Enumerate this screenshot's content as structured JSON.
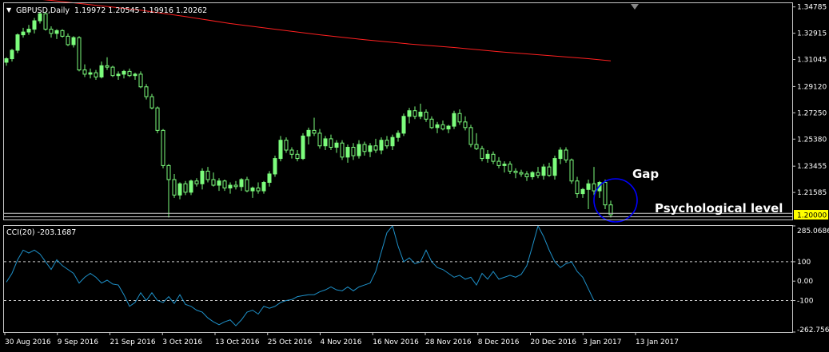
{
  "header": {
    "menu_arrow": "▼",
    "symbol_text": "GBPUSD,Daily  1.19972 1.20545 1.19916 1.20262"
  },
  "subwindow": {
    "label": "CCI(20) -203.1687"
  },
  "colors": {
    "background": "#000000",
    "border": "#c8c8c8",
    "bull_candle": "#7cfc7c",
    "bear_candle": "#000000",
    "wick": "#7cfc7c",
    "moving_average": "#ff2020",
    "cci_line": "#1e90c8",
    "annotation_circle": "#0000ff",
    "price_tag_bg": "#ffff00"
  },
  "chart_data": [
    {
      "type": "candlestick",
      "title": "GBPUSD,Daily",
      "x_labels": [
        "30 Aug 2016",
        "9 Sep 2016",
        "21 Sep 2016",
        "3 Oct 2016",
        "13 Oct 2016",
        "25 Oct 2016",
        "4 Nov 2016",
        "16 Nov 2016",
        "28 Nov 2016",
        "8 Dec 2016",
        "20 Dec 2016",
        "3 Jan 2017",
        "13 Jan 2017"
      ],
      "y_ticks": [
        "1.34785",
        "1.32915",
        "1.31045",
        "1.29120",
        "1.27250",
        "1.25380",
        "1.23455",
        "1.21585"
      ],
      "ylim": [
        1.1966,
        1.3505
      ],
      "current_price_label": "1.20000",
      "horizontal_levels": [
        1.201,
        1.1985
      ],
      "annotations": {
        "gap": "Gap",
        "psych": "Psychological level"
      },
      "candles": [
        [
          1.3085,
          1.312,
          1.306,
          1.311
        ],
        [
          1.311,
          1.318,
          1.309,
          1.317
        ],
        [
          1.317,
          1.329,
          1.315,
          1.328
        ],
        [
          1.328,
          1.333,
          1.326,
          1.33
        ],
        [
          1.33,
          1.335,
          1.328,
          1.332
        ],
        [
          1.332,
          1.34,
          1.329,
          1.338
        ],
        [
          1.338,
          1.344,
          1.336,
          1.343
        ],
        [
          1.343,
          1.3445,
          1.331,
          1.332
        ],
        [
          1.332,
          1.334,
          1.326,
          1.329
        ],
        [
          1.329,
          1.332,
          1.325,
          1.331
        ],
        [
          1.331,
          1.332,
          1.326,
          1.327
        ],
        [
          1.327,
          1.329,
          1.32,
          1.321
        ],
        [
          1.321,
          1.327,
          1.319,
          1.326
        ],
        [
          1.326,
          1.327,
          1.302,
          1.303
        ],
        [
          1.303,
          1.307,
          1.298,
          1.3
        ],
        [
          1.3,
          1.304,
          1.297,
          1.301
        ],
        [
          1.301,
          1.303,
          1.296,
          1.298
        ],
        [
          1.298,
          1.309,
          1.297,
          1.306
        ],
        [
          1.306,
          1.312,
          1.303,
          1.305
        ],
        [
          1.305,
          1.306,
          1.298,
          1.299
        ],
        [
          1.299,
          1.302,
          1.296,
          1.3
        ],
        [
          1.3,
          1.303,
          1.297,
          1.302
        ],
        [
          1.302,
          1.304,
          1.298,
          1.299
        ],
        [
          1.299,
          1.301,
          1.296,
          1.3
        ],
        [
          1.3,
          1.302,
          1.29,
          1.291
        ],
        [
          1.291,
          1.293,
          1.282,
          1.284
        ],
        [
          1.284,
          1.286,
          1.275,
          1.276
        ],
        [
          1.276,
          1.277,
          1.258,
          1.26
        ],
        [
          1.26,
          1.261,
          1.233,
          1.235
        ],
        [
          1.235,
          1.236,
          1.198,
          1.225
        ],
        [
          1.225,
          1.229,
          1.212,
          1.214
        ],
        [
          1.214,
          1.223,
          1.211,
          1.222
        ],
        [
          1.222,
          1.224,
          1.214,
          1.216
        ],
        [
          1.216,
          1.225,
          1.214,
          1.224
        ],
        [
          1.224,
          1.226,
          1.22,
          1.222
        ],
        [
          1.222,
          1.233,
          1.218,
          1.231
        ],
        [
          1.231,
          1.234,
          1.223,
          1.225
        ],
        [
          1.225,
          1.23,
          1.22,
          1.221
        ],
        [
          1.221,
          1.226,
          1.217,
          1.224
        ],
        [
          1.224,
          1.225,
          1.217,
          1.219
        ],
        [
          1.219,
          1.223,
          1.215,
          1.221
        ],
        [
          1.221,
          1.224,
          1.218,
          1.22
        ],
        [
          1.22,
          1.226,
          1.217,
          1.225
        ],
        [
          1.225,
          1.227,
          1.216,
          1.217
        ],
        [
          1.217,
          1.22,
          1.212,
          1.219
        ],
        [
          1.219,
          1.223,
          1.215,
          1.217
        ],
        [
          1.217,
          1.224,
          1.215,
          1.223
        ],
        [
          1.223,
          1.231,
          1.22,
          1.229
        ],
        [
          1.229,
          1.242,
          1.227,
          1.24
        ],
        [
          1.24,
          1.256,
          1.238,
          1.253
        ],
        [
          1.253,
          1.255,
          1.244,
          1.246
        ],
        [
          1.246,
          1.248,
          1.24,
          1.243
        ],
        [
          1.243,
          1.246,
          1.238,
          1.24
        ],
        [
          1.24,
          1.258,
          1.239,
          1.256
        ],
        [
          1.256,
          1.262,
          1.25,
          1.26
        ],
        [
          1.26,
          1.269,
          1.256,
          1.258
        ],
        [
          1.258,
          1.261,
          1.247,
          1.249
        ],
        [
          1.249,
          1.256,
          1.246,
          1.254
        ],
        [
          1.254,
          1.257,
          1.246,
          1.248
        ],
        [
          1.248,
          1.253,
          1.244,
          1.251
        ],
        [
          1.251,
          1.253,
          1.239,
          1.241
        ],
        [
          1.241,
          1.25,
          1.237,
          1.248
        ],
        [
          1.248,
          1.251,
          1.239,
          1.242
        ],
        [
          1.242,
          1.253,
          1.24,
          1.25
        ],
        [
          1.25,
          1.252,
          1.242,
          1.245
        ],
        [
          1.245,
          1.251,
          1.241,
          1.249
        ],
        [
          1.249,
          1.254,
          1.244,
          1.246
        ],
        [
          1.246,
          1.255,
          1.243,
          1.253
        ],
        [
          1.253,
          1.256,
          1.247,
          1.249
        ],
        [
          1.249,
          1.257,
          1.246,
          1.255
        ],
        [
          1.255,
          1.26,
          1.252,
          1.258
        ],
        [
          1.258,
          1.272,
          1.256,
          1.27
        ],
        [
          1.27,
          1.276,
          1.265,
          1.274
        ],
        [
          1.274,
          1.277,
          1.268,
          1.27
        ],
        [
          1.27,
          1.279,
          1.268,
          1.273
        ],
        [
          1.273,
          1.275,
          1.266,
          1.268
        ],
        [
          1.268,
          1.27,
          1.261,
          1.262
        ],
        [
          1.262,
          1.266,
          1.258,
          1.264
        ],
        [
          1.264,
          1.267,
          1.26,
          1.261
        ],
        [
          1.261,
          1.264,
          1.258,
          1.263
        ],
        [
          1.263,
          1.274,
          1.261,
          1.272
        ],
        [
          1.272,
          1.275,
          1.264,
          1.266
        ],
        [
          1.266,
          1.27,
          1.26,
          1.262
        ],
        [
          1.262,
          1.264,
          1.248,
          1.25
        ],
        [
          1.25,
          1.258,
          1.246,
          1.247
        ],
        [
          1.247,
          1.249,
          1.238,
          1.24
        ],
        [
          1.24,
          1.246,
          1.237,
          1.243
        ],
        [
          1.243,
          1.245,
          1.236,
          1.238
        ],
        [
          1.238,
          1.241,
          1.233,
          1.235
        ],
        [
          1.235,
          1.238,
          1.23,
          1.236
        ],
        [
          1.236,
          1.238,
          1.229,
          1.231
        ],
        [
          1.231,
          1.233,
          1.226,
          1.23
        ],
        [
          1.23,
          1.232,
          1.227,
          1.229
        ],
        [
          1.229,
          1.231,
          1.224,
          1.227
        ],
        [
          1.227,
          1.231,
          1.225,
          1.23
        ],
        [
          1.23,
          1.234,
          1.226,
          1.228
        ],
        [
          1.228,
          1.236,
          1.225,
          1.234
        ],
        [
          1.234,
          1.237,
          1.227,
          1.228
        ],
        [
          1.228,
          1.242,
          1.225,
          1.24
        ],
        [
          1.24,
          1.248,
          1.236,
          1.246
        ],
        [
          1.246,
          1.248,
          1.237,
          1.239
        ],
        [
          1.239,
          1.24,
          1.222,
          1.224
        ],
        [
          1.224,
          1.227,
          1.212,
          1.215
        ],
        [
          1.215,
          1.219,
          1.212,
          1.218
        ],
        [
          1.218,
          1.225,
          1.204,
          1.222
        ],
        [
          1.222,
          1.234,
          1.214,
          1.217
        ],
        [
          1.217,
          1.224,
          1.212,
          1.223
        ],
        [
          1.223,
          1.225,
          1.204,
          1.207
        ],
        [
          1.207,
          1.21,
          1.198,
          1.2
        ]
      ]
    },
    {
      "type": "line",
      "series_name": "moving average",
      "x_index": [
        0,
        8,
        16,
        24,
        32,
        40,
        48,
        56,
        64,
        72,
        80,
        88,
        96,
        104,
        108
      ],
      "values": [
        1.3555,
        1.3525,
        1.349,
        1.3455,
        1.341,
        1.336,
        1.332,
        1.328,
        1.3245,
        1.3215,
        1.319,
        1.316,
        1.3135,
        1.311,
        1.3095
      ]
    },
    {
      "type": "line",
      "title": "CCI(20) -203.1687",
      "y_ticks": [
        "285.0686",
        "100",
        "0.00",
        "-100",
        "-262.7568"
      ],
      "ylim": [
        -262.7568,
        285.0686
      ],
      "levels": [
        100,
        -100
      ],
      "values": [
        -5,
        40,
        110,
        160,
        145,
        160,
        140,
        100,
        60,
        110,
        80,
        60,
        40,
        -10,
        20,
        40,
        20,
        -10,
        5,
        -15,
        -20,
        -70,
        -130,
        -110,
        -60,
        -100,
        -60,
        -100,
        -110,
        -80,
        -115,
        -70,
        -120,
        -130,
        -150,
        -160,
        -190,
        -210,
        -225,
        -210,
        -200,
        -230,
        -200,
        -160,
        -150,
        -170,
        -130,
        -140,
        -130,
        -110,
        -100,
        -95,
        -80,
        -75,
        -70,
        -70,
        -55,
        -45,
        -30,
        -45,
        -50,
        -30,
        -50,
        -30,
        -20,
        -10,
        50,
        150,
        250,
        285,
        180,
        100,
        120,
        90,
        100,
        160,
        100,
        70,
        60,
        40,
        20,
        30,
        10,
        20,
        -20,
        40,
        10,
        50,
        10,
        20,
        30,
        20,
        35,
        80,
        180,
        285,
        230,
        160,
        100,
        70,
        90,
        100,
        50,
        20,
        -40,
        -100
      ]
    }
  ]
}
